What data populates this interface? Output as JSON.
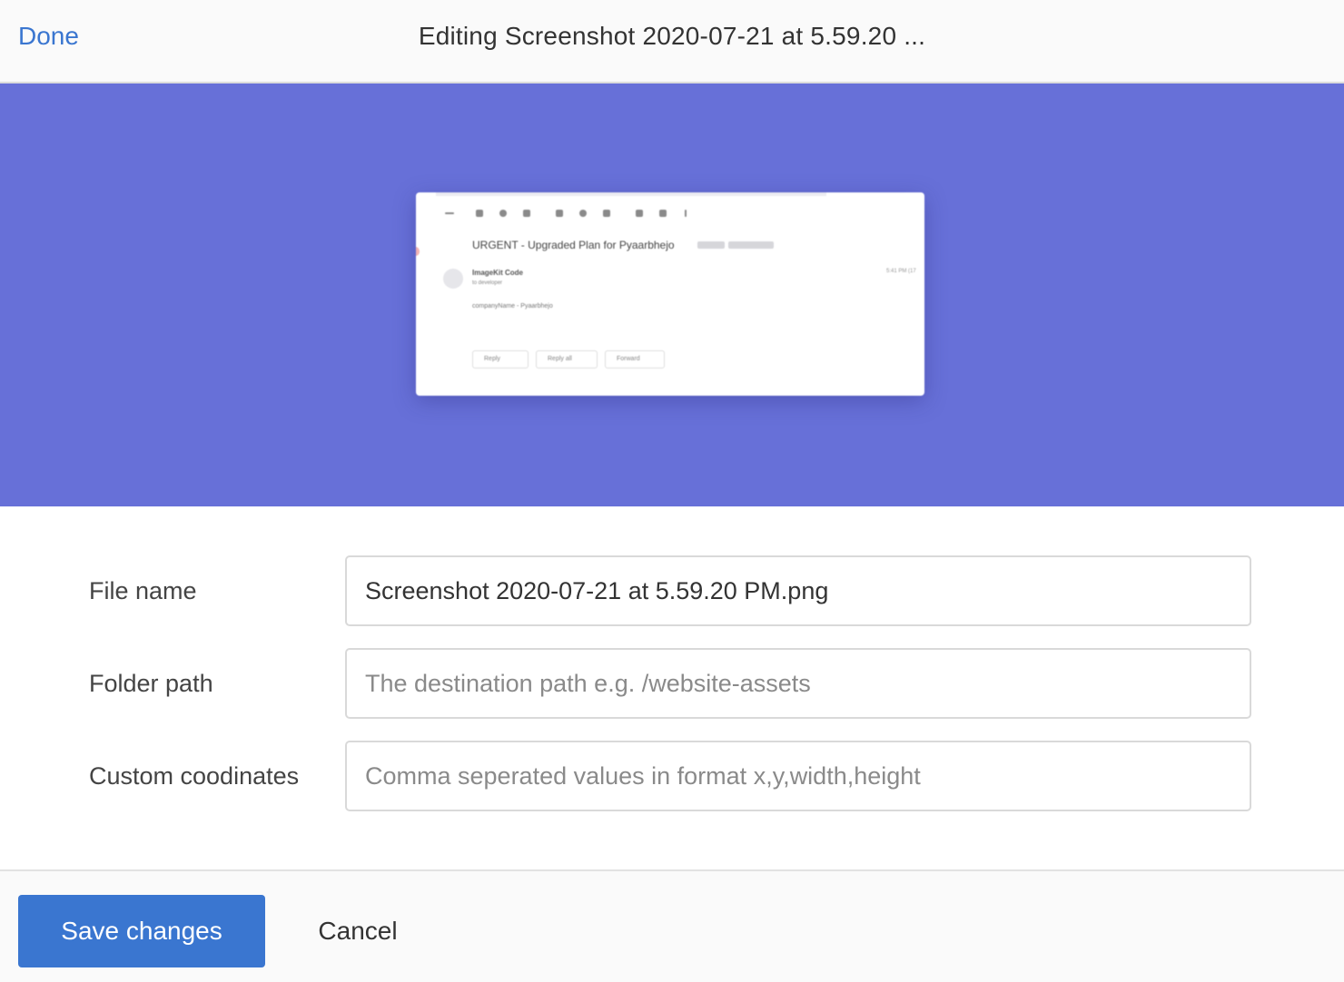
{
  "header": {
    "done_label": "Done",
    "title": "Editing Screenshot 2020-07-21 at 5.59.20 ..."
  },
  "preview": {
    "background_color": "#6770d8",
    "image": {
      "subject": "URGENT - Upgraded Plan for Pyaarbhejo",
      "sender": "ImageKit Code",
      "recipient": "to developer",
      "time": "5:41 PM (17",
      "body": "companyName - Pyaarbhejo",
      "reply_label": "Reply",
      "reply_all_label": "Reply all",
      "forward_label": "Forward"
    }
  },
  "form": {
    "file_name": {
      "label": "File name",
      "value": "Screenshot 2020-07-21 at 5.59.20 PM.png",
      "placeholder": ""
    },
    "folder_path": {
      "label": "Folder path",
      "value": "",
      "placeholder": "The destination path e.g. /website-assets"
    },
    "custom_coordinates": {
      "label": "Custom coodinates",
      "value": "",
      "placeholder": "Comma seperated values in format x,y,width,height"
    }
  },
  "footer": {
    "save_label": "Save changes",
    "cancel_label": "Cancel"
  },
  "colors": {
    "accent": "#3a76d0",
    "preview_bg": "#6770d8"
  }
}
